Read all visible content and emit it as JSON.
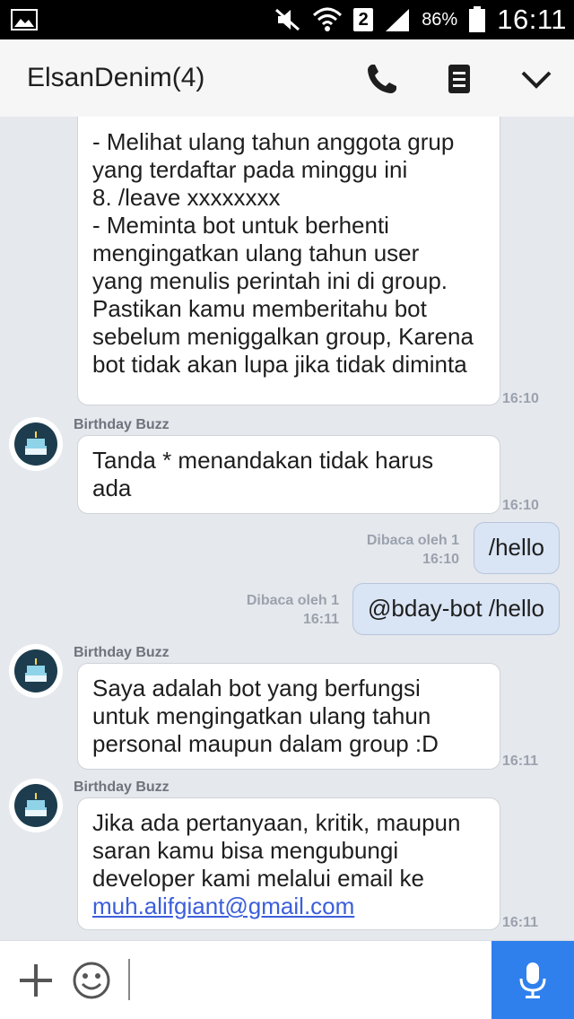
{
  "status_bar": {
    "sim_slot": "2",
    "battery": "86%",
    "time": "16:11"
  },
  "header": {
    "title": "ElsanDenim(4)"
  },
  "messages": [
    {
      "text": "- Melihat ulang tahun anggota grup\nyang terdaftar pada minggu ini\n8. /leave xxxxxxxx\n- Meminta bot untuk berhenti\nmengingatkan ulang tahun user\nyang menulis perintah ini di group.\nPastikan kamu memberitahu bot\nsebelum meniggalkan group, Karena\nbot tidak akan lupa jika tidak diminta",
      "time": "16:10"
    },
    {
      "sender": "Birthday Buzz",
      "text": "Tanda * menandakan tidak harus\nada",
      "time": "16:10"
    },
    {
      "read": "Dibaca oleh 1",
      "time": "16:10",
      "text": "/hello"
    },
    {
      "read": "Dibaca oleh 1",
      "time": "16:11",
      "text": "@bday-bot /hello"
    },
    {
      "sender": "Birthday Buzz",
      "text": "Saya adalah bot yang berfungsi\nuntuk mengingatkan ulang tahun\npersonal maupun dalam group :D",
      "time": "16:11"
    },
    {
      "sender": "Birthday Buzz",
      "text": "Jika ada pertanyaan, kritik, maupun\nsaran kamu bisa mengubungi\ndeveloper kami melalui email ke",
      "link": "muh.alifgiant@gmail.com",
      "time": "16:11"
    }
  ],
  "input": {
    "placeholder": ""
  },
  "icons": {
    "header": [
      "phone-icon",
      "menu-icon",
      "chevron-down-icon"
    ],
    "input": [
      "plus-icon",
      "emoji-icon",
      "mic-icon"
    ],
    "avatar": "birthday-cake-icon"
  },
  "colors": {
    "accent": "#2f80ed",
    "outgoing_bubble": "#d9e4f4",
    "link": "#3b5edb",
    "chat_bg": "#e5e8ed"
  }
}
